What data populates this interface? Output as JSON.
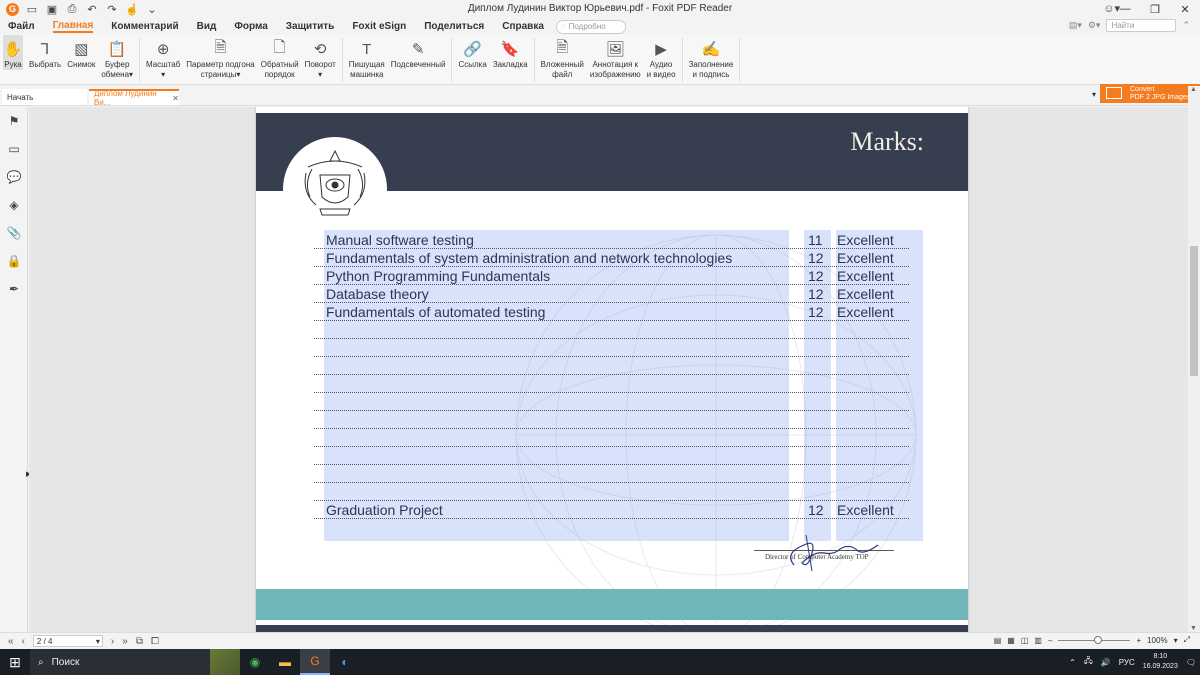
{
  "titlebar": {
    "window_title": "Диплом Лудинин Виктор Юрьевич.pdf - Foxit PDF Reader"
  },
  "menu": {
    "items": [
      "Файл",
      "Главная",
      "Комментарий",
      "Вид",
      "Форма",
      "Защитить",
      "Foxit eSign",
      "Поделиться",
      "Справка"
    ],
    "active_index": 1,
    "search_placeholder": "Подробно",
    "find_placeholder": "Найти"
  },
  "ribbon": {
    "buttons": [
      {
        "label": "Рука",
        "icon": "hand-icon"
      },
      {
        "label": "Выбрать",
        "icon": "select-icon"
      },
      {
        "label": "Снимок",
        "icon": "snapshot-icon"
      },
      {
        "label": "Буфер\nобмена▾",
        "icon": "clipboard-icon"
      },
      {
        "label": "Масштаб\n▾",
        "icon": "zoom-icon"
      },
      {
        "label": "Параметр подгона\nстраницы▾",
        "icon": "fit-page-icon"
      },
      {
        "label": "Обратный\nпорядок",
        "icon": "reverse-order-icon"
      },
      {
        "label": "Поворот\n▾",
        "icon": "rotate-icon"
      },
      {
        "label": "Пишущая\nмашинка",
        "icon": "typewriter-icon"
      },
      {
        "label": "Подсвеченный",
        "icon": "highlight-icon"
      },
      {
        "label": "Ссылка",
        "icon": "link-icon"
      },
      {
        "label": "Закладка",
        "icon": "bookmark-icon"
      },
      {
        "label": "Вложенный\nфайл",
        "icon": "attachment-icon"
      },
      {
        "label": "Аннотация к\nизображению",
        "icon": "image-annotation-icon"
      },
      {
        "label": "Аудио\nи видео",
        "icon": "media-icon"
      },
      {
        "label": "Заполнение\nи подпись",
        "icon": "fill-sign-icon"
      }
    ]
  },
  "tabs": {
    "start_label": "Начать",
    "doc_label": "Диплом Лудинин Ви...",
    "close_glyph": "✕"
  },
  "convert": {
    "line1": "Convert",
    "line2": "PDF 2 JPG Images"
  },
  "document": {
    "title": "Marks:",
    "rows": [
      {
        "subject": "Manual software testing",
        "mark": "11",
        "grade": "Excellent"
      },
      {
        "subject": "Fundamentals of system administration and network technologies",
        "mark": "12",
        "grade": "Excellent"
      },
      {
        "subject": "Python Programming Fundamentals",
        "mark": "12",
        "grade": "Excellent"
      },
      {
        "subject": "Database theory",
        "mark": "12",
        "grade": "Excellent"
      },
      {
        "subject": "Fundamentals of automated testing",
        "mark": "12",
        "grade": "Excellent"
      }
    ],
    "final_row": {
      "subject": "Graduation Project",
      "mark": "12",
      "grade": "Excellent"
    },
    "signature_caption": "Director of Computer Academy TOP"
  },
  "statusbar": {
    "page": "2 / 4",
    "zoom": "100%"
  },
  "taskbar": {
    "search_label": "Поиск",
    "lang": "РУС",
    "time": "8:10",
    "date": "16.09.2023"
  },
  "colors": {
    "accent": "#f47c20",
    "header_band": "#363e4f",
    "teal_band": "#6fb6b9",
    "highlight": "#7896f0"
  }
}
